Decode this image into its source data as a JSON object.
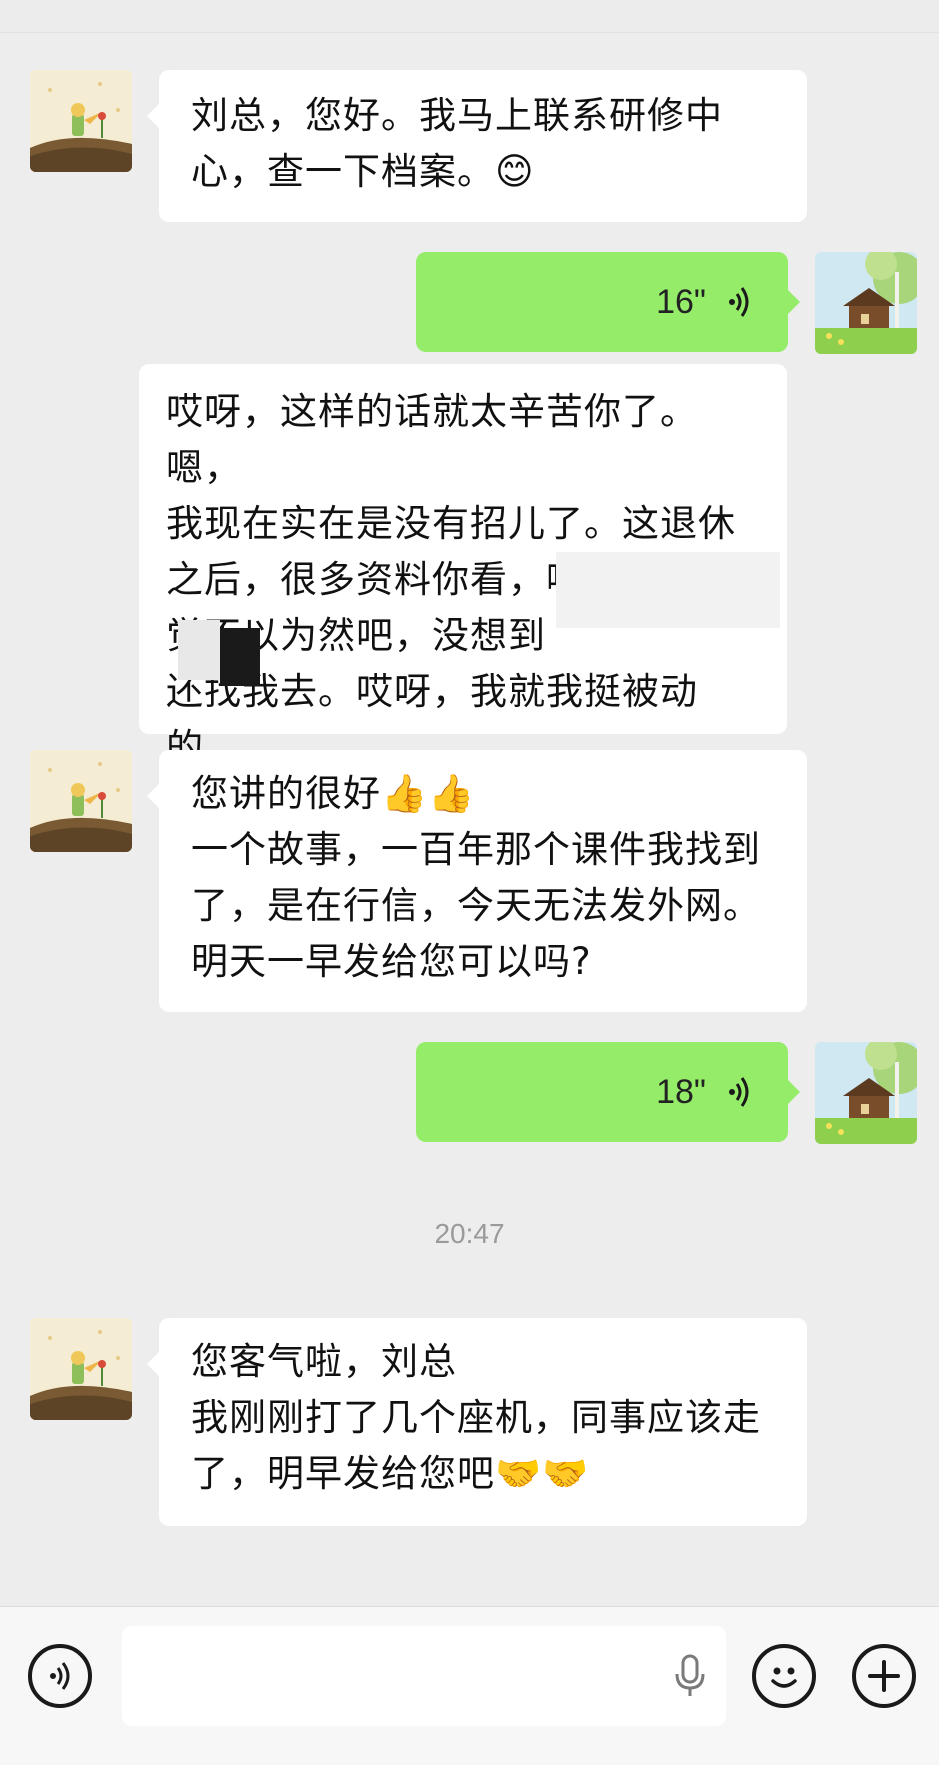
{
  "messages": [
    {
      "side": "left",
      "type": "text",
      "text": "刘总，您好。我马上联系研修中\n心，查一下档案。😊"
    },
    {
      "side": "right",
      "type": "voice",
      "duration": "16\""
    },
    {
      "side": "left",
      "type": "text",
      "text": "哎呀，这样的话就太辛苦你了。嗯，\n我现在实在是没有招儿了。这退休\n之后，很多资料你看，嗯，当初感\n觉不以为然吧，没想到\n还找我去。哎呀，我就我挺被动的，\n麻烦你，拜托你了，看看吧。"
    },
    {
      "side": "left",
      "type": "text",
      "text": "您讲的很好👍👍\n一个故事，一百年那个课件我找到\n了，是在行信，今天无法发外网。\n明天一早发给您可以吗?"
    },
    {
      "side": "right",
      "type": "voice",
      "duration": "18\""
    },
    {
      "side": "left",
      "type": "text",
      "text": "您客气啦，刘总\n我刚刚打了几个座机，同事应该走\n了，明早发给您吧🤝🤝"
    }
  ],
  "timestamp": "20:47",
  "footer": {
    "voice_toggle_icon": "voice-toggle-icon",
    "input_placeholder": "",
    "mic_icon": "microphone-icon",
    "emoji_icon": "emoji-icon",
    "plus_icon": "plus-icon"
  }
}
